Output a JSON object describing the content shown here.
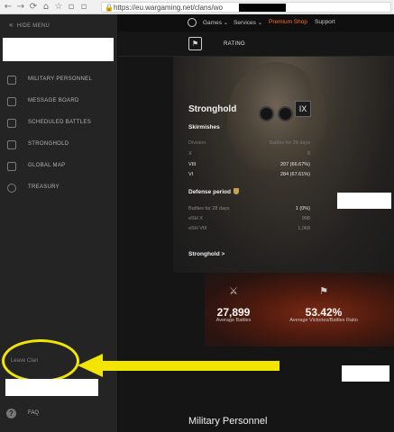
{
  "browser": {
    "url": "https://eu.wargaming.net/clans/wo",
    "nav_glyphs": [
      "←",
      "→",
      "⟳",
      "⌂",
      "☆"
    ]
  },
  "sidebar": {
    "hide_label": "HIDE MENU",
    "items": [
      {
        "label": "MILITARY PERSONNEL",
        "icon": "personnel-icon"
      },
      {
        "label": "MESSAGE BOARD",
        "icon": "message-board-icon"
      },
      {
        "label": "SCHEDULED BATTLES",
        "icon": "crossed-swords-icon"
      },
      {
        "label": "STRONGHOLD",
        "icon": "fortress-icon"
      },
      {
        "label": "GLOBAL MAP",
        "icon": "globe-map-icon"
      },
      {
        "label": "TREASURY",
        "icon": "coins-icon"
      }
    ],
    "leave_clan": "Leave Clan",
    "faq": "FAQ"
  },
  "topnav": {
    "games": "Games ⌄",
    "services": "Services ⌄",
    "premium": "Premium Shop",
    "support": "Support",
    "premium_color": "#ff6b2b"
  },
  "clanbar": {
    "rating_tab": "RATING"
  },
  "stronghold": {
    "title": "Stronghold",
    "tier": "IX",
    "skirmishes": {
      "title": "Skirmishes",
      "header": {
        "label": "Division",
        "value": "Battles for 28 days"
      },
      "rows": [
        {
          "label": "X",
          "value": "0"
        },
        {
          "label": "VIII",
          "value": "207 (66.67%)"
        },
        {
          "label": "VI",
          "value": "284 (67.61%)"
        }
      ]
    },
    "defense": {
      "title": "Defense period",
      "rows": [
        {
          "label": "Battles for 28 days",
          "value": "1 (0%)"
        },
        {
          "label": "eSH X",
          "value": "998"
        },
        {
          "label": "eSH VIII",
          "value": "1,068"
        }
      ]
    },
    "link": "Stronghold >"
  },
  "stats": {
    "battles": {
      "value": "27,899",
      "label": "Average Battles"
    },
    "ratio": {
      "value": "53.42%",
      "label": "Average Victories/Battles Ratio"
    }
  },
  "section_title": "Military Personnel",
  "annotation": {
    "color": "#f2e600"
  }
}
